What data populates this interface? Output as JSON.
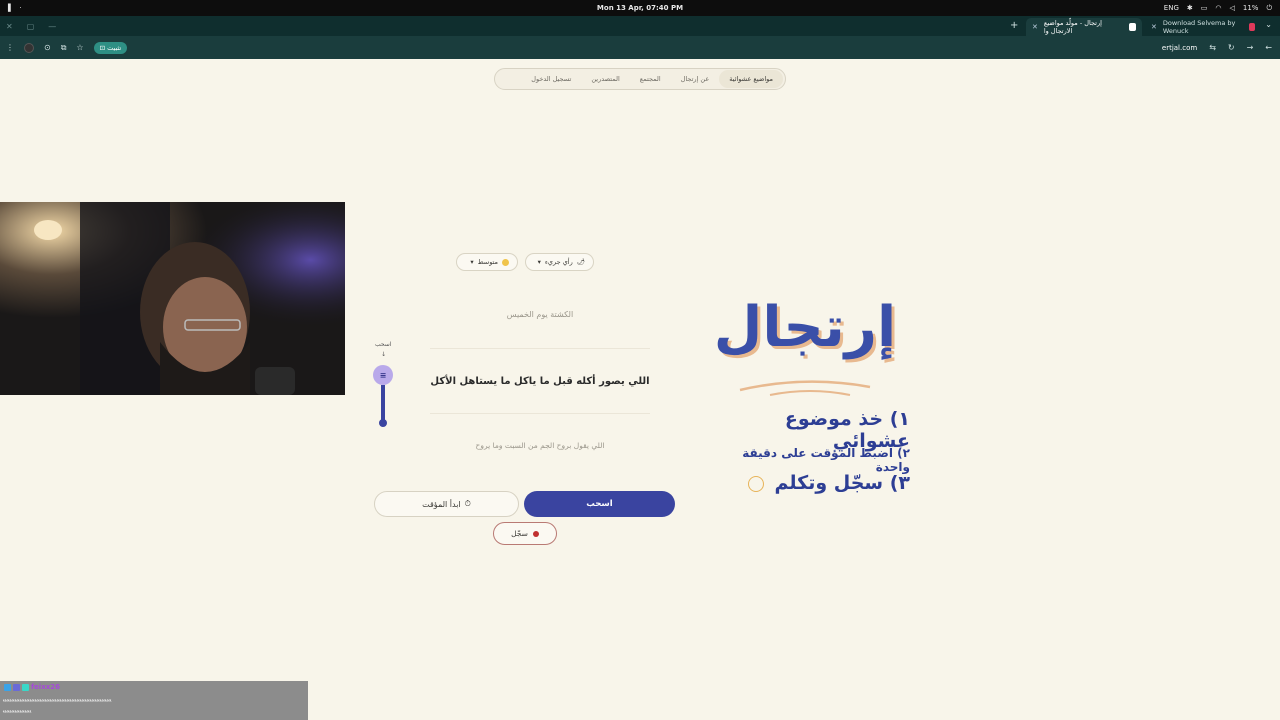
{
  "os": {
    "clock": "Mon 13 Apr, 07:40 PM",
    "lang": "ENG",
    "battery": "11%"
  },
  "browser": {
    "tabs": [
      {
        "title": "إرتجال - مولّد مواضيع الارتجال وا",
        "active": true
      },
      {
        "title": "Download Selvema by Wenuck",
        "active": false
      }
    ],
    "install_label": "تثبيت",
    "url": "ertjal.com"
  },
  "nav": {
    "items": [
      "مواضيع عشوائية",
      "عن إرتجال",
      "المجتمع",
      "المتصدرين",
      "تسجيل الدخول"
    ]
  },
  "chips": {
    "category": "رأي جريء",
    "difficulty": "متوسط"
  },
  "topics": {
    "prev": "الكشتة يوم الخميس",
    "current": "اللي يصور أكله قبل ما ياكل ما يستاهل الأكل",
    "next": "اللي يقول بروح الجم من السبت وما يروح"
  },
  "slider": {
    "label": "اسحب",
    "arrow": "↓"
  },
  "buttons": {
    "draw": "اسحب",
    "timer": "ابدأ المؤقت",
    "record": "سجّل"
  },
  "brand": {
    "logo": "إرتجال",
    "steps": [
      "١) خذ موضوع عشوائي",
      "٢) اضبط المؤقت على دقيقة واحدة",
      "٣) سجّل وتكلم"
    ]
  },
  "chat": {
    "username": "feixx26",
    "message_line1": "ﯾﯾﯾﯾﯾﯾﯾﯾﯾﯾﯾﯾﯾﯾﯾﯾﯾﯾﯾﯾﯾﯾﯾﯾﯾﯾﯾﯾﯾﯾﯾﯾﯾﯾﯾﯾﯾﯾﯾﯾﯾﯾﯾﯾﯾﯾﯾﯾﯾﯾﯾﯾﯾﯾﯾﯾﯾﯾﯾﯾﯾﯾﯾﯾﯾ",
    "message_line2": "ﯾﯾﯾﯾﯾﯾﯾﯾﯾﯾﯾﯾﯾﯾﯾﯾﯾ"
  },
  "colors": {
    "primary": "#3a44a0",
    "background": "#f8f5ea",
    "accent_orange": "#e8b98f",
    "record_red": "#c0302f"
  }
}
